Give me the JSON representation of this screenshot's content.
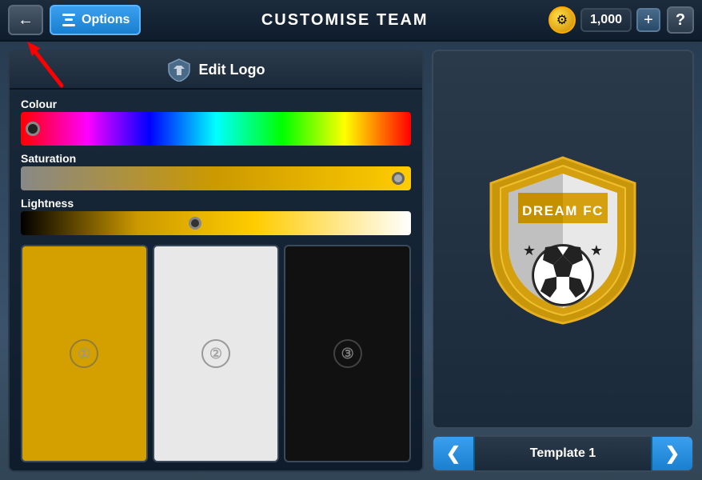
{
  "topbar": {
    "back_arrow": "←",
    "options_label": "Options",
    "title": "CUSTOMISE TEAM",
    "coin_icon": "⚙",
    "coin_amount": "1,000",
    "plus_label": "+",
    "help_label": "?"
  },
  "panel": {
    "title": "Edit Logo",
    "colour_label": "Colour",
    "saturation_label": "Saturation",
    "lightness_label": "Lightness"
  },
  "swatches": [
    {
      "number": "①",
      "id": "1"
    },
    {
      "number": "②",
      "id": "2"
    },
    {
      "number": "③",
      "id": "3"
    }
  ],
  "logo": {
    "team_name": "DREAM FC"
  },
  "template_nav": {
    "left_arrow": "❮",
    "label": "Template 1",
    "right_arrow": "❯"
  }
}
